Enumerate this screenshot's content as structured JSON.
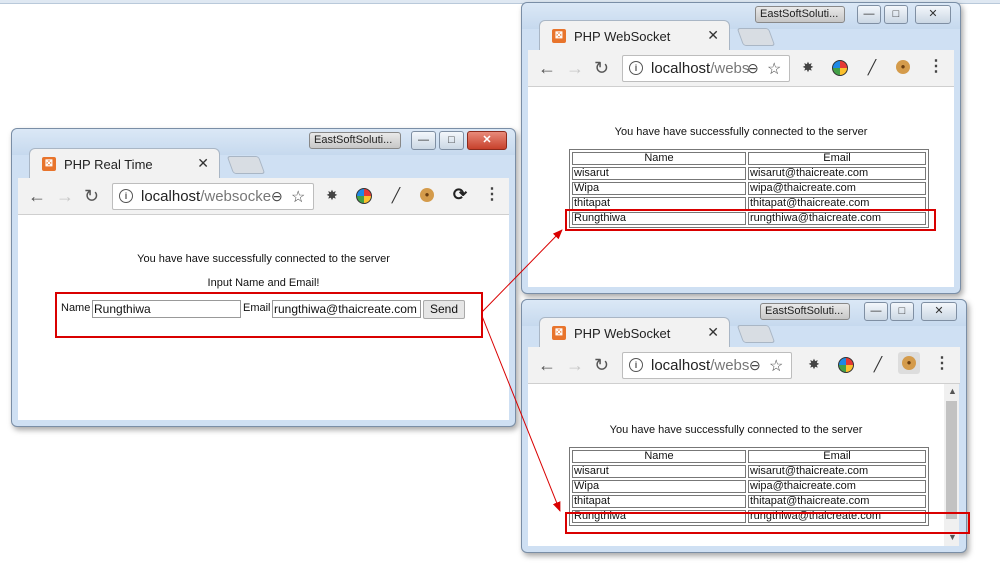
{
  "colors": {
    "highlight": "#d90000",
    "arrow": "#d90000"
  },
  "windows": {
    "sender": {
      "badge": "EastSoftSoluti...",
      "tab_title": "PHP Real Time",
      "favicon": "xampp-icon",
      "url_host": "localhost",
      "url_path": "/websocke",
      "status": "You have have successfully connected to the server",
      "prompt": "Input Name and Email!",
      "name_label": "Name",
      "name_value": "Rungthiwa",
      "email_label": "Email",
      "email_value": "rungthiwa@thaicreate.com",
      "send_label": "Send"
    },
    "receiver1": {
      "badge": "EastSoftSoluti...",
      "tab_title": "PHP WebSocket",
      "url_host": "localhost",
      "url_path": "/webs",
      "status": "You have have successfully connected to the server",
      "columns": [
        "Name",
        "Email"
      ],
      "rows": [
        [
          "wisarut",
          "wisarut@thaicreate.com"
        ],
        [
          "Wipa",
          "wipa@thaicreate.com"
        ],
        [
          "thitapat",
          "thitapat@thaicreate.com"
        ],
        [
          "Rungthiwa",
          "rungthiwa@thaicreate.com"
        ]
      ]
    },
    "receiver2": {
      "badge": "EastSoftSoluti...",
      "tab_title": "PHP WebSocket",
      "url_host": "localhost",
      "url_path": "/webs",
      "status": "You have have successfully connected to the server",
      "columns": [
        "Name",
        "Email"
      ],
      "rows": [
        [
          "wisarut",
          "wisarut@thaicreate.com"
        ],
        [
          "Wipa",
          "wipa@thaicreate.com"
        ],
        [
          "thitapat",
          "thitapat@thaicreate.com"
        ],
        [
          "Rungthiwa",
          "rungthiwa@thaicreate.com"
        ]
      ]
    }
  },
  "icons": [
    "back-arrow-icon",
    "forward-arrow-icon",
    "reload-icon",
    "info-icon",
    "zoom-icon",
    "star-icon",
    "bug-icon",
    "color-wheel-icon",
    "pen-icon",
    "cookie-icon",
    "sync-icon",
    "menu-icon"
  ]
}
